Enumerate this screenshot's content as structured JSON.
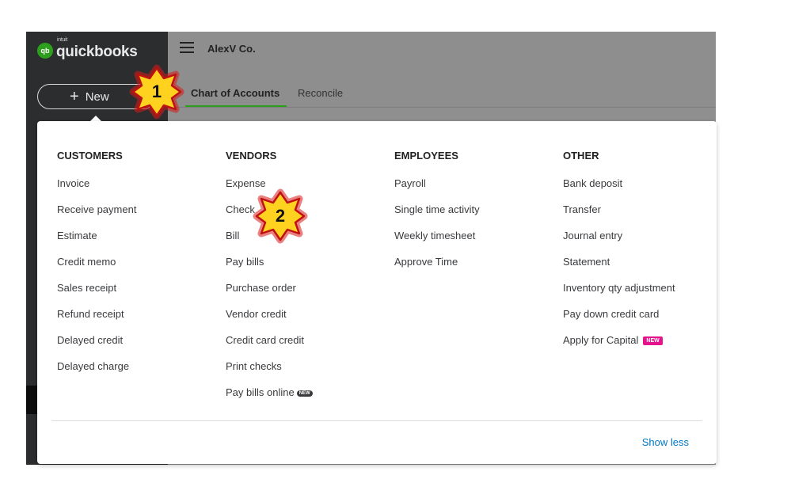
{
  "sidebar": {
    "logo_small": "intuit",
    "logo_text": "quickbooks",
    "logo_badge": "qb",
    "new_label": "New",
    "new_icon": "plus-icon"
  },
  "header": {
    "company_name": "AlexV Co.",
    "menu_icon": "hamburger-menu-icon"
  },
  "tabs": [
    {
      "label": "Chart of Accounts",
      "active": true
    },
    {
      "label": "Reconcile",
      "active": false
    }
  ],
  "menu": {
    "customers": {
      "title": "CUSTOMERS",
      "items": [
        "Invoice",
        "Receive payment",
        "Estimate",
        "Credit memo",
        "Sales receipt",
        "Refund receipt",
        "Delayed credit",
        "Delayed charge"
      ]
    },
    "vendors": {
      "title": "VENDORS",
      "items": [
        "Expense",
        "Check",
        "Bill",
        "Pay bills",
        "Purchase order",
        "Vendor credit",
        "Credit card credit",
        "Print checks",
        "Pay bills online"
      ],
      "badge_last": "NEW"
    },
    "employees": {
      "title": "EMPLOYEES",
      "items": [
        "Payroll",
        "Single time activity",
        "Weekly timesheet",
        "Approve Time"
      ]
    },
    "other": {
      "title": "OTHER",
      "items": [
        "Bank deposit",
        "Transfer",
        "Journal entry",
        "Statement",
        "Inventory qty adjustment",
        "Pay down credit card",
        "Apply for Capital"
      ],
      "badge_last": "NEW"
    },
    "show_less": "Show less"
  },
  "callouts": [
    {
      "number": "1"
    },
    {
      "number": "2"
    }
  ],
  "colors": {
    "brand_green": "#2ca01c",
    "link_blue": "#0077c5",
    "badge_pink": "#e5148c",
    "callout_fill": "#ffd21f",
    "callout_glow": "#d71a1a"
  }
}
